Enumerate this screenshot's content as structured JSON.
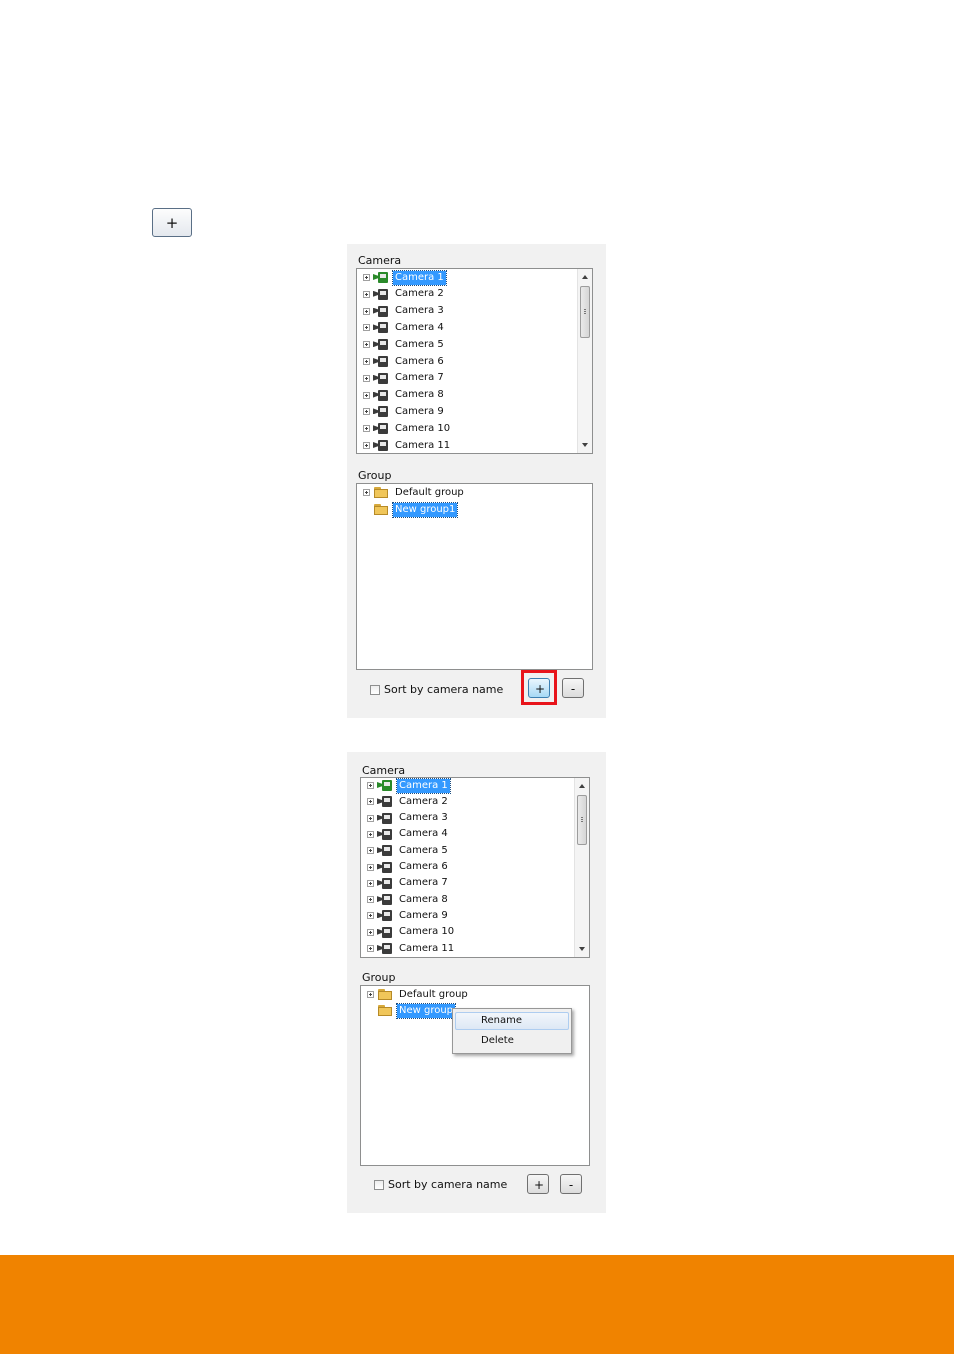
{
  "inline_button": {
    "label": "+"
  },
  "panel1": {
    "camera_section_title": "Camera",
    "cameras": [
      {
        "label": "Camera 1",
        "selected": true
      },
      {
        "label": "Camera 2"
      },
      {
        "label": "Camera 3"
      },
      {
        "label": "Camera 4"
      },
      {
        "label": "Camera 5"
      },
      {
        "label": "Camera 6"
      },
      {
        "label": "Camera 7"
      },
      {
        "label": "Camera 8"
      },
      {
        "label": "Camera 9"
      },
      {
        "label": "Camera 10"
      },
      {
        "label": "Camera 11"
      }
    ],
    "group_section_title": "Group",
    "groups": [
      {
        "label": "Default group",
        "expandable": true
      },
      {
        "label": "New group1",
        "selected": true
      }
    ],
    "sort_label": "Sort by camera name",
    "add_label": "+",
    "remove_label": "-"
  },
  "panel2": {
    "camera_section_title": "Camera",
    "cameras": [
      {
        "label": "Camera 1",
        "selected": true
      },
      {
        "label": "Camera 2"
      },
      {
        "label": "Camera 3"
      },
      {
        "label": "Camera 4"
      },
      {
        "label": "Camera 5"
      },
      {
        "label": "Camera 6"
      },
      {
        "label": "Camera 7"
      },
      {
        "label": "Camera 8"
      },
      {
        "label": "Camera 9"
      },
      {
        "label": "Camera 10"
      },
      {
        "label": "Camera 11"
      }
    ],
    "group_section_title": "Group",
    "groups": [
      {
        "label": "Default group",
        "expandable": true
      },
      {
        "label": "New group",
        "selected": true
      }
    ],
    "context_menu": [
      "Rename",
      "Delete"
    ],
    "sort_label": "Sort by camera name",
    "add_label": "+",
    "remove_label": "-"
  },
  "colors": {
    "footer": "#f08300",
    "selection": "#3399ff",
    "highlight": "#e8141b"
  }
}
